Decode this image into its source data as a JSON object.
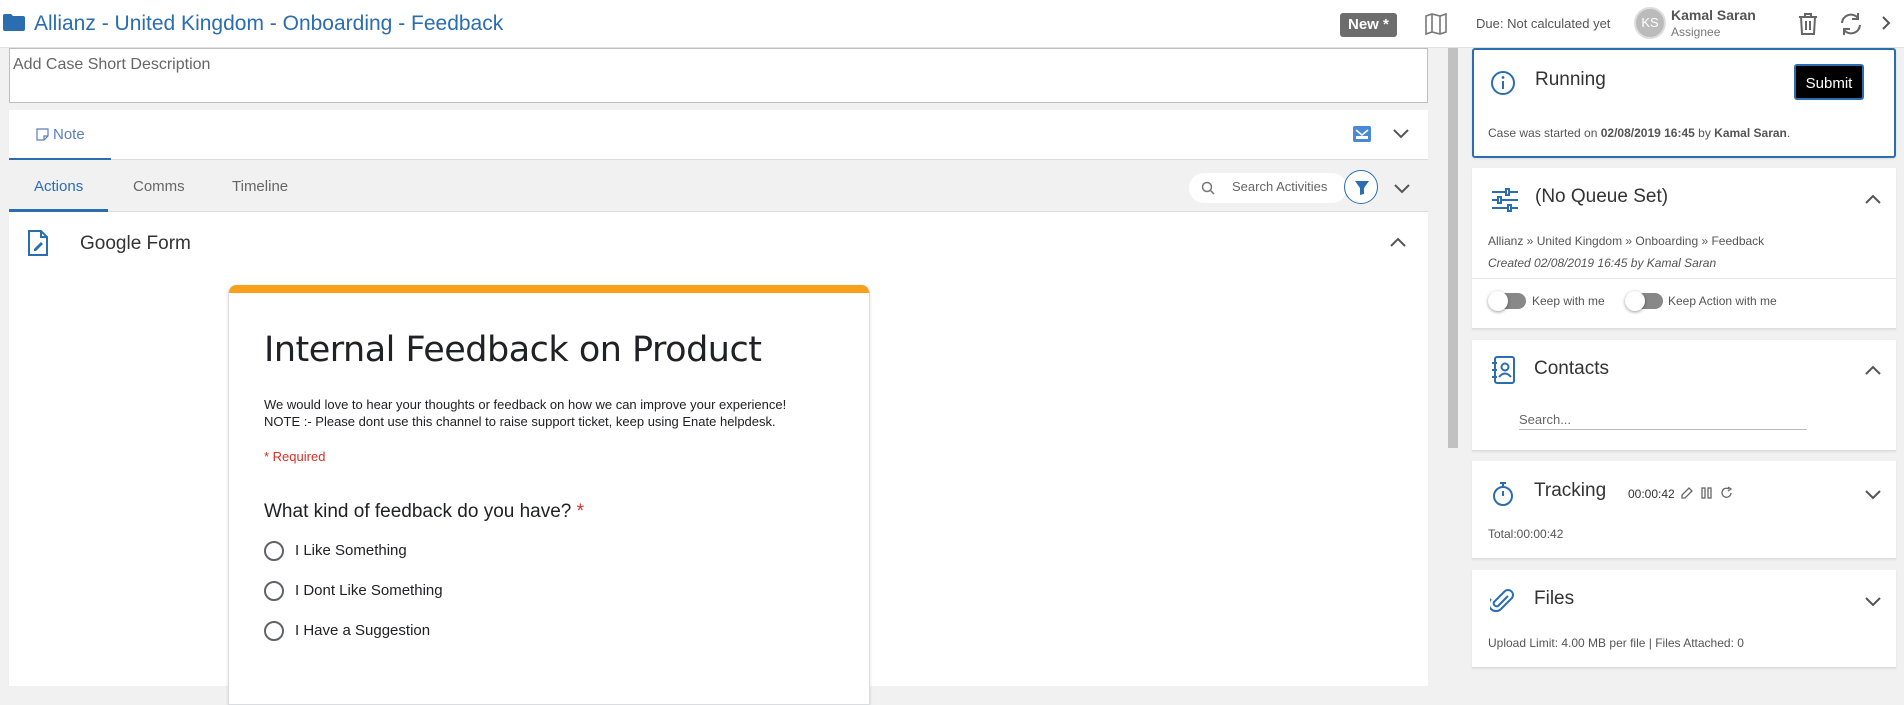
{
  "header": {
    "title": "Allianz - United Kingdom - Onboarding - Feedback",
    "badge": "New *",
    "due": "Due: Not calculated yet",
    "assignee_initials": "KS",
    "assignee_name": "Kamal Saran",
    "assignee_role": "Assignee"
  },
  "description": {
    "placeholder": "Add Case Short Description"
  },
  "note_bar": {
    "tab_label": "Note"
  },
  "activity_tabs": {
    "tabs": [
      "Actions",
      "Comms",
      "Timeline"
    ],
    "active": "Actions",
    "search_placeholder": "Search Activities"
  },
  "form_section": {
    "title": "Google Form"
  },
  "google_form": {
    "accent_color": "#f7a01c",
    "title": "Internal Feedback on Product",
    "description_line1": "We would love to hear your thoughts or feedback on how we can improve your experience!",
    "description_line2": "NOTE :- Please dont use this channel to raise support ticket, keep using Enate helpdesk.",
    "required_note": "* Required",
    "question": "What kind of feedback do you have?",
    "question_required_mark": "*",
    "options": [
      "I Like Something",
      "I Dont Like Something",
      "I Have a Suggestion"
    ]
  },
  "panels": {
    "running": {
      "title": "Running",
      "submit_label": "Submit",
      "started_prefix": "Case was started on ",
      "started_date": "02/08/2019 16:45",
      "started_by_word": " by ",
      "started_by": "Kamal Saran",
      "started_suffix": "."
    },
    "queue": {
      "title": "(No Queue Set)",
      "breadcrumb": "Allianz » United Kingdom » Onboarding » Feedback",
      "created": "Created 02/08/2019 16:45 by Kamal Saran",
      "toggle1_label": "Keep with me",
      "toggle2_label": "Keep Action with me"
    },
    "contacts": {
      "title": "Contacts",
      "search_placeholder": "Search..."
    },
    "tracking": {
      "title": "Tracking",
      "timer": "00:00:42",
      "total": "Total:00:00:42"
    },
    "files": {
      "title": "Files",
      "limit": "Upload Limit: 4.00 MB per file | Files Attached: 0"
    }
  },
  "colors": {
    "brand_blue": "#2a6db0",
    "required_red": "#d93025"
  }
}
